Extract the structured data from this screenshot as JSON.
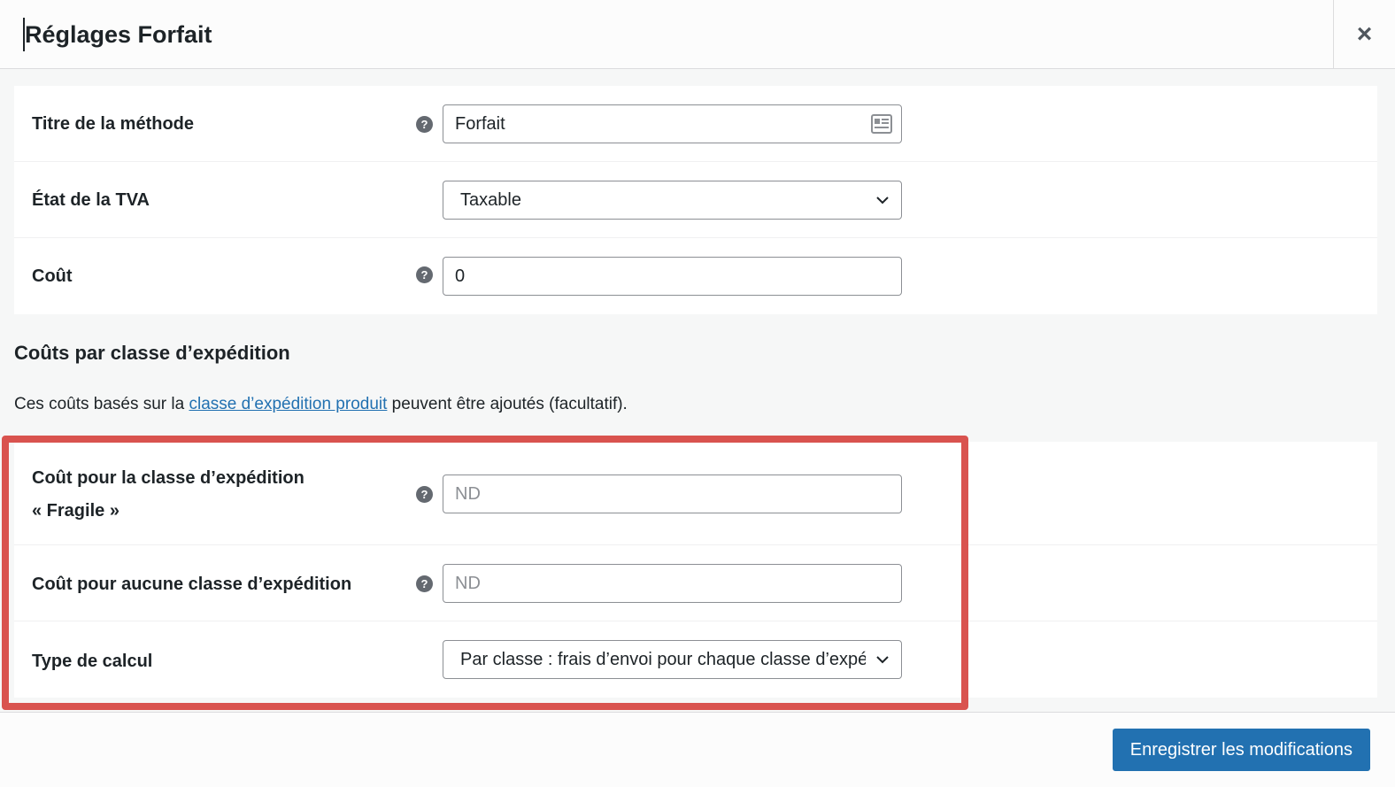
{
  "modal": {
    "title": "Réglages Forfait",
    "close_label": "×"
  },
  "general_settings": [
    {
      "label": "Titre de la méthode",
      "has_help": true,
      "type": "text",
      "value": "Forfait",
      "placeholder": ""
    },
    {
      "label": "État de la TVA",
      "has_help": false,
      "type": "select",
      "value": "Taxable"
    },
    {
      "label": "Coût",
      "has_help": true,
      "type": "text",
      "value": "0",
      "placeholder": ""
    }
  ],
  "class_costs": {
    "heading": "Coûts par classe d’expédition",
    "desc_before": "Ces coûts basés sur la ",
    "desc_link": "classe d’expédition produit",
    "desc_after": " peuvent être ajoutés (facultatif).",
    "rows": [
      {
        "label_line1": "Coût pour la classe d’expédition",
        "label_line2": "« Fragile »",
        "has_help": true,
        "type": "text",
        "value": "",
        "placeholder": "ND"
      },
      {
        "label_line1": "Coût pour aucune classe d’expédition",
        "has_help": true,
        "type": "text",
        "value": "",
        "placeholder": "ND"
      },
      {
        "label_line1": "Type de calcul",
        "has_help": false,
        "type": "select",
        "value": "Par classe : frais d’envoi pour chaque classe d’expédition"
      }
    ]
  },
  "footer": {
    "save_label": "Enregistrer les modifications"
  },
  "colors": {
    "accent": "#2271b1",
    "highlight_border": "#d9534f",
    "help_icon": "#646970"
  },
  "help_glyph": "?"
}
